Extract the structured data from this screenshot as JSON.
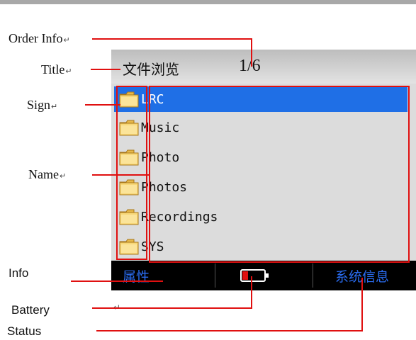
{
  "annotations": {
    "order_info": "Order Info",
    "title": "Title",
    "sign": "Sign",
    "name": "Name",
    "info": "Info",
    "battery": "Battery",
    "status": "Status",
    "return_mark": "↵"
  },
  "screen": {
    "title": "文件浏览",
    "order": "1/6",
    "items": [
      {
        "name": "LRC",
        "selected": true
      },
      {
        "name": "Music",
        "selected": false
      },
      {
        "name": "Photo",
        "selected": false
      },
      {
        "name": "Photos",
        "selected": false
      },
      {
        "name": "Recordings",
        "selected": false
      },
      {
        "name": "SYS",
        "selected": false
      }
    ],
    "bottom": {
      "info": "属性",
      "status": "系统信息",
      "battery_level": 0.25
    }
  },
  "icons": {
    "folder": "folder-icon",
    "battery": "battery-icon"
  },
  "colors": {
    "highlight": "#1f6fe6",
    "annotation_line": "#e01010",
    "softkey_text": "#2a6cf0",
    "bottom_bar": "#000000"
  }
}
